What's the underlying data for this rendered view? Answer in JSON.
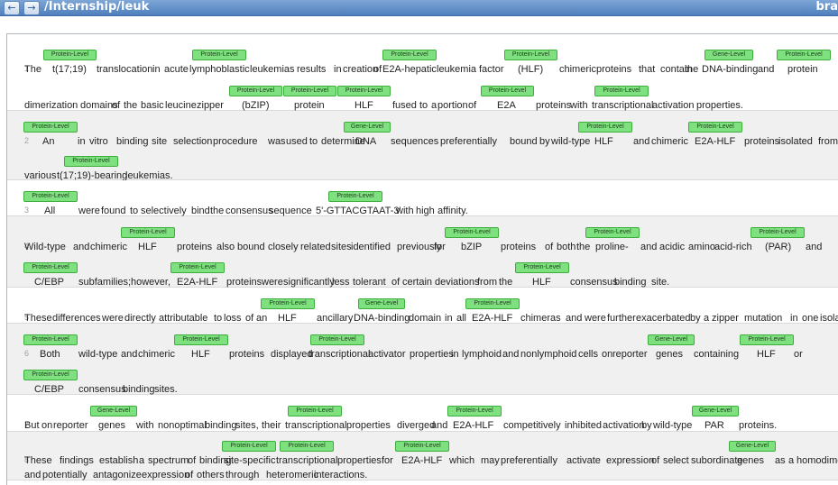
{
  "toolbar": {
    "title": "/Internship/leuk",
    "right_fragment": "bra",
    "back_icon": "arrow-left-icon",
    "forward_icon": "arrow-right-icon"
  },
  "label_types": {
    "protein": "Protein-Level",
    "gene": "Gene-Level"
  },
  "colors": {
    "label_bg": "#7fe07f",
    "label_border": "#3cae3c",
    "toolbar_bg": "#5a88c3",
    "alt_row_bg": "#f0f0f0"
  },
  "sentences": [
    {
      "number": "1",
      "tokens": [
        "The",
        "t(17;19)",
        "translocation",
        "in",
        "acute",
        "lymphoblastic",
        "leukemias",
        "results",
        "in",
        "creation",
        "of",
        "E2A-hepatic",
        "leukemia",
        "factor",
        "(HLF)",
        "chimeric",
        "proteins",
        "that",
        "contain",
        "the",
        "DNA-binding",
        "and",
        "protein",
        "dimerization",
        "domains",
        "of",
        "the",
        "basic",
        "leucine",
        "zipper",
        "(bZIP)",
        "protein",
        "HLF",
        "fused",
        "to",
        "a",
        "portion",
        "of",
        "E2A",
        "proteins",
        "with",
        "transcriptional",
        "activation",
        "properties."
      ],
      "labels": [
        "Protein-Level",
        "Protein-Level",
        "Protein-Level",
        "Protein-Level",
        "Gene-Level",
        "Protein-Level",
        "Protein-Level",
        "Protein-Level",
        "Protein-Level",
        "Protein-Level",
        "Protein-Level"
      ]
    },
    {
      "number": "2",
      "tokens": [
        "An",
        "in",
        "vitro",
        "binding",
        "site",
        "selection",
        "procedure",
        "was",
        "used",
        "to",
        "determine",
        "DNA",
        "sequences",
        "preferentially",
        "bound",
        "by",
        "wild-type",
        "HLF",
        "and",
        "chimeric",
        "E2A-HLF",
        "proteins",
        "isolated",
        "from",
        "various",
        "t(17;19)-bearing",
        "leukemias."
      ],
      "labels": [
        "Protein-Level",
        "Gene-Level",
        "Protein-Level",
        "Protein-Level",
        "Protein-Level"
      ]
    },
    {
      "number": "3",
      "tokens": [
        "All",
        "were",
        "found",
        "to",
        "selectively",
        "bind",
        "the",
        "consensus",
        "sequence",
        "5'-GTTACGTAAT-3'",
        "with",
        "high",
        "affinity."
      ],
      "labels": [
        "Protein-Level",
        "Protein-Level"
      ]
    },
    {
      "number": "4",
      "tokens": [
        "Wild-type",
        "and",
        "chimeric",
        "HLF",
        "proteins",
        "also",
        "bound",
        "closely",
        "related",
        "sites",
        "identified",
        "previously",
        "for",
        "bZIP",
        "proteins",
        "of",
        "both",
        "the",
        "proline-",
        "and",
        "acidic",
        "amino",
        "acid-rich",
        "(PAR)",
        "and",
        "C/EBP",
        "subfamilies;",
        "however,",
        "E2A-HLF",
        "proteins",
        "were",
        "significantly",
        "less",
        "tolerant",
        "of",
        "certain",
        "deviations",
        "from",
        "the",
        "HLF",
        "consensus",
        "binding",
        "site."
      ],
      "labels": [
        "Protein-Level",
        "Protein-Level",
        "Protein-Level",
        "Protein-Level",
        "Protein-Level",
        "Protein-Level",
        "Protein-Level"
      ]
    },
    {
      "number": "5",
      "tokens": [
        "These",
        "differences",
        "were",
        "directly",
        "attributable",
        "to",
        "loss",
        "of",
        "an",
        "HLF",
        "ancillary",
        "DNA-binding",
        "domain",
        "in",
        "all",
        "E2A-HLF",
        "chimeras",
        "and",
        "were",
        "further",
        "exacerbated",
        "by",
        "a",
        "zipper",
        "mutation",
        "in",
        "one",
        "isolate."
      ],
      "labels": [
        "Protein-Level",
        "Gene-Level",
        "Protein-Level"
      ]
    },
    {
      "number": "6",
      "tokens": [
        "Both",
        "wild-type",
        "and",
        "chimeric",
        "HLF",
        "proteins",
        "displayed",
        "transcriptional",
        "activator",
        "properties",
        "in",
        "lymphoid",
        "and",
        "nonlymphoid",
        "cells",
        "on",
        "reporter",
        "genes",
        "containing",
        "HLF",
        "or",
        "C/EBP",
        "consensus",
        "binding",
        "sites."
      ],
      "labels": [
        "Protein-Level",
        "Protein-Level",
        "Protein-Level",
        "Gene-Level",
        "Protein-Level",
        "Protein-Level"
      ]
    },
    {
      "number": "7",
      "tokens": [
        "But",
        "on",
        "reporter",
        "genes",
        "with",
        "nonoptimal",
        "binding",
        "sites,",
        "their",
        "transcriptional",
        "properties",
        "diverged",
        "and",
        "E2A-HLF",
        "competitively",
        "inhibited",
        "activation",
        "by",
        "wild-type",
        "PAR",
        "proteins."
      ],
      "labels": [
        "Gene-Level",
        "Protein-Level",
        "Protein-Level",
        "Gene-Level"
      ]
    },
    {
      "number": "8",
      "tokens": [
        "These",
        "findings",
        "establish",
        "a",
        "spectrum",
        "of",
        "binding",
        "site-specific",
        "transcriptional",
        "properties",
        "for",
        "E2A-HLF",
        "which",
        "may",
        "preferentially",
        "activate",
        "expression",
        "of",
        "select",
        "subordinate",
        "genes",
        "as",
        "a",
        "homodime",
        "and",
        "potentially",
        "antagonize",
        "expression",
        "of",
        "others",
        "through",
        "heteromeric",
        "interactions."
      ],
      "labels": [
        "Protein-Level",
        "Protein-Level",
        "Protein-Level",
        "Gene-Level"
      ]
    }
  ]
}
